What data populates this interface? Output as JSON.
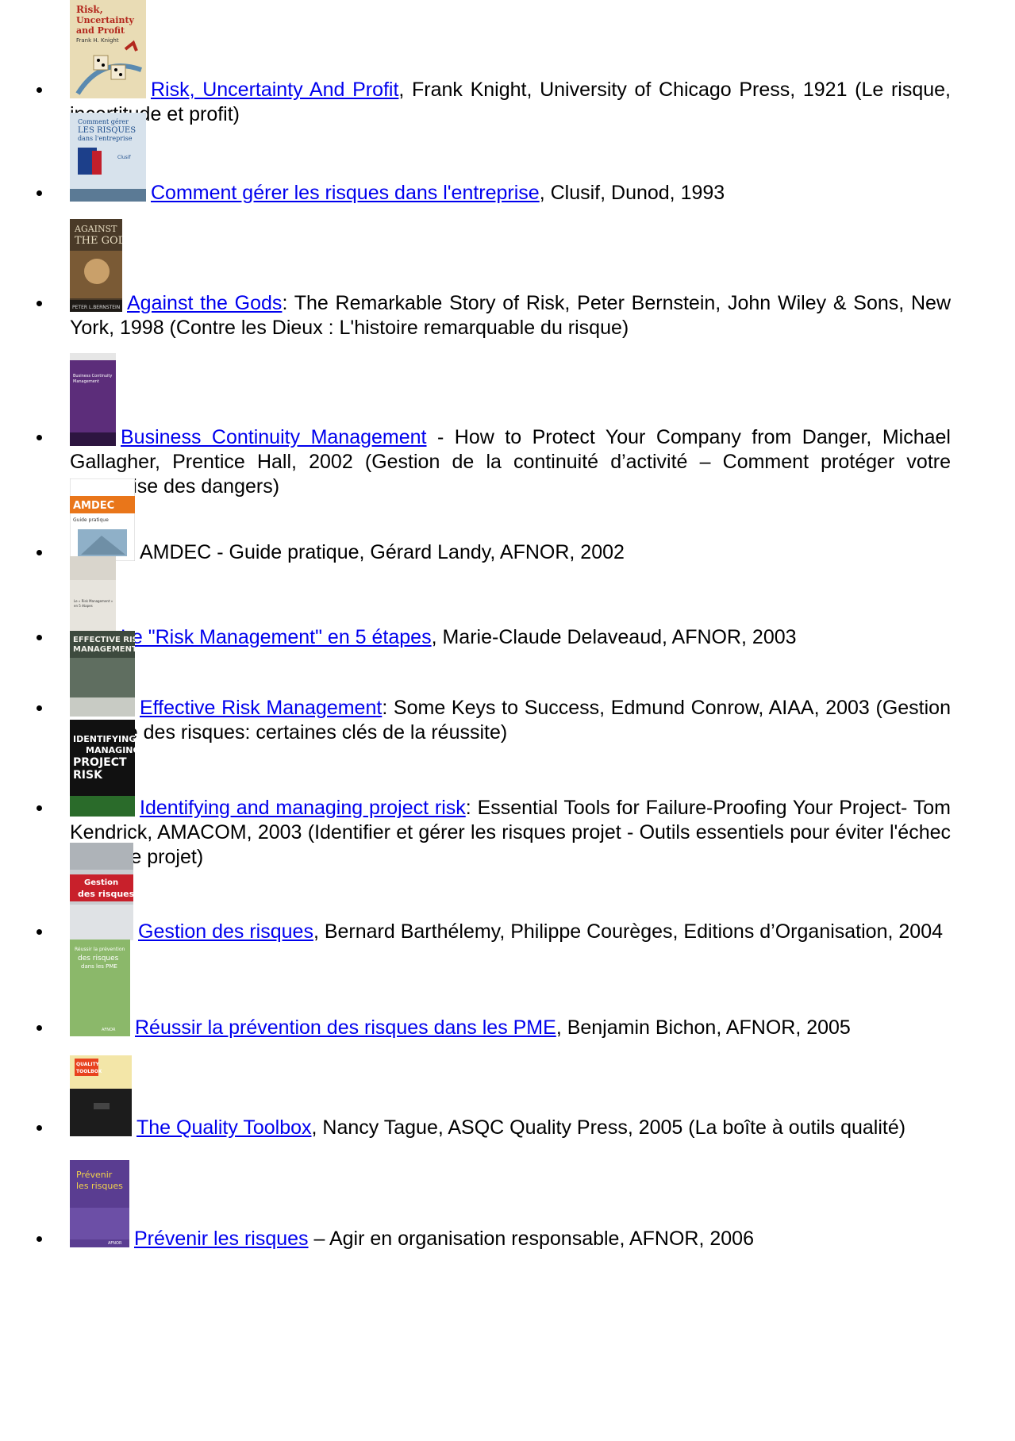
{
  "books": [
    {
      "cover_text": "Risk, Uncertainty and Profit Frank H. Knight",
      "title": "Risk, Uncertainty And Profit",
      "rest": ", Frank Knight, University of Chicago Press, 1921 (Le risque, incertitude et profit)"
    },
    {
      "cover_text": "Comment gérer LES RISQUES dans l'entreprise Clusif",
      "title": "Comment gérer les risques dans l'entreprise",
      "rest": ", Clusif, Dunod, 1993"
    },
    {
      "cover_text": "AGAINST THE GODS PETER L. BERNSTEIN",
      "title": "Against the Gods",
      "rest": ": The Remarkable Story of Risk, Peter Bernstein, John Wiley & Sons, New York, 1998 (Contre les Dieux : L'histoire remarquable du risque)"
    },
    {
      "cover_text": "Business Continuity Management",
      "title": "Business Continuity Management",
      "rest": " - How to Protect Your Company from Danger, Michael Gallagher, Prentice Hall, 2002 (Gestion de la continuité d’activité – Comment protéger votre enterprise des dangers)"
    },
    {
      "cover_text": "AMDEC Guide pratique",
      "title": "",
      "rest": "AMDEC - Guide pratique, Gérard Landy, AFNOR, 2002"
    },
    {
      "cover_text": "Le « Risk Management » en 5 étapes",
      "title": "Le \"Risk Management\" en 5 étapes",
      "rest": ", Marie-Claude Delaveaud, AFNOR, 2003"
    },
    {
      "cover_text": "EFFECTIVE RISK MANAGEMENT",
      "title": "Effective Risk Management",
      "rest": ": Some Keys to Success, Edmund Conrow, AIAA, 2003 (Gestion efficace des risques: certaines clés de la réussite)"
    },
    {
      "cover_text": "IDENTIFYING MANAGING PROJECT RISK",
      "title": "Identifying and managing project risk",
      "rest": ": Essential Tools for Failure-Proofing Your Project-  Tom Kendrick, AMACOM, 2003 (Identifier et gérer les risques projet - Outils essentiels pour éviter l'échec de votre projet)"
    },
    {
      "cover_text": "Gestion des risques",
      "title": "Gestion des risques",
      "rest": ", Bernard Barthélemy, Philippe Courèges, Editions d’Organisation, 2004"
    },
    {
      "cover_text": "Réussir la prévention des risques dans les PME",
      "title": "Réussir la prévention des risques dans les PME",
      "rest": ", Benjamin Bichon, AFNOR, 2005"
    },
    {
      "cover_text": "QUALITY TOOLBOX",
      "title": "The Quality Toolbox",
      "rest": ", Nancy Tague, ASQC Quality Press, 2005 (La boîte à outils qualité)"
    },
    {
      "cover_text": "Prévenir les risques AFNOR",
      "title": "Prévenir les risques",
      "rest": " – Agir en organisation responsable, AFNOR, 2006"
    }
  ]
}
